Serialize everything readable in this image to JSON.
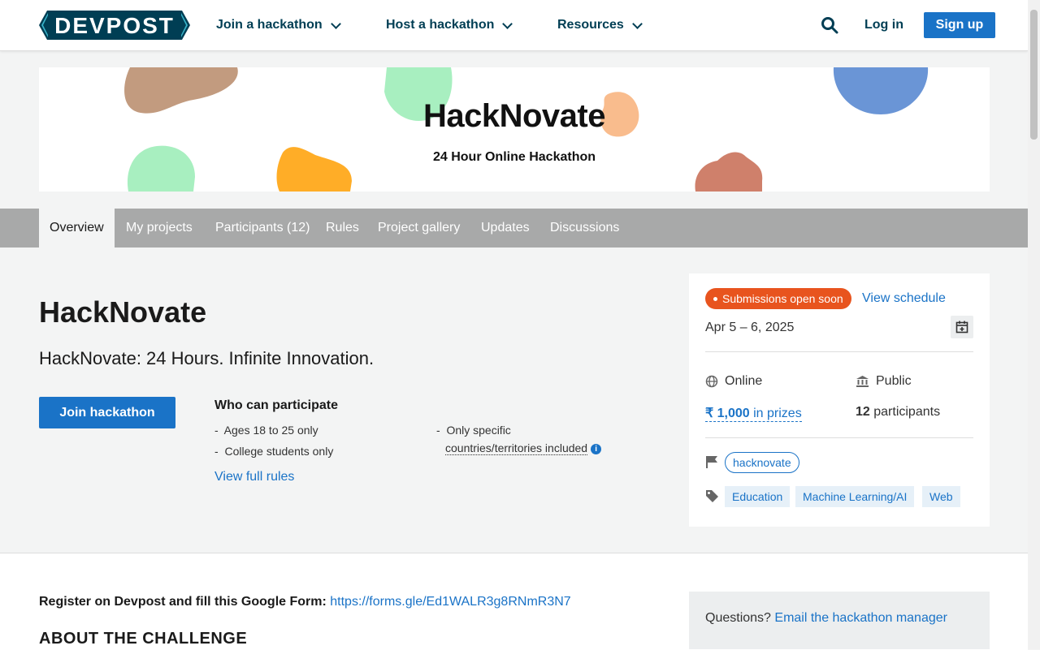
{
  "brand": {
    "logo_text": "DEVPOST",
    "accent": "#1a73c7",
    "logo_color": "#003e54"
  },
  "nav": {
    "join": "Join a hackathon",
    "host": "Host a hackathon",
    "resources": "Resources",
    "login": "Log in",
    "signup": "Sign up"
  },
  "banner": {
    "title": "HackNovate",
    "subtitle": "24 Hour Online Hackathon"
  },
  "tabs": [
    {
      "label": "Overview",
      "active": true
    },
    {
      "label": "My projects"
    },
    {
      "label": "Participants (12)"
    },
    {
      "label": "Rules"
    },
    {
      "label": "Project gallery"
    },
    {
      "label": "Updates"
    },
    {
      "label": "Discussions"
    }
  ],
  "main": {
    "title": "HackNovate",
    "tagline": "HackNovate: 24 Hours. Infinite Innovation.",
    "join_button": "Join hackathon",
    "who_title": "Who can participate",
    "rules": [
      "Ages 18 to 25 only",
      "College students only",
      "Only specific",
      "countries/territories included"
    ],
    "view_full_rules": "View full rules"
  },
  "sidebar": {
    "status_badge": "Submissions open soon",
    "status_color": "#e8541e",
    "view_schedule": "View schedule",
    "dates": "Apr 5 – 6, 2025",
    "location": "Online",
    "visibility": "Public",
    "prize_amount": "₹ 1,000",
    "prize_suffix": "in prizes",
    "participants_count": "12",
    "participants_label": "participants",
    "host_tag": "hacknovate",
    "themes": [
      "Education",
      "Machine Learning/AI",
      "Web"
    ]
  },
  "lower": {
    "register_label": "Register on Devpost and fill this Google Form:",
    "register_link": "https://forms.gle/Ed1WALR3g8RNmR3N7",
    "about_heading": "ABOUT THE CHALLENGE",
    "questions_label": "Questions?",
    "questions_link": "Email the hackathon manager"
  }
}
